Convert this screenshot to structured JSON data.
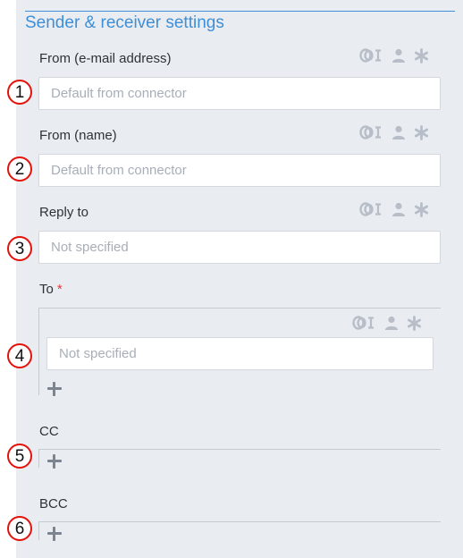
{
  "section": {
    "title": "Sender & receiver settings"
  },
  "fields": {
    "from_email": {
      "label": "From (e-mail address)",
      "placeholder": "Default from connector",
      "marker": "1"
    },
    "from_name": {
      "label": "From (name)",
      "placeholder": "Default from connector",
      "marker": "2"
    },
    "reply_to": {
      "label": "Reply to",
      "placeholder": "Not specified",
      "marker": "3"
    },
    "to": {
      "label": "To",
      "required_mark": "*",
      "placeholder": "Not specified",
      "marker": "4"
    },
    "cc": {
      "label": "CC",
      "marker": "5"
    },
    "bcc": {
      "label": "BCC",
      "marker": "6"
    }
  },
  "icon_names": [
    "link-variable-icon",
    "user-icon",
    "asterisk-icon"
  ],
  "colors": {
    "accent": "#3f8fd6",
    "panel_bg": "#e9ecf1",
    "icon_muted": "#b7bec8",
    "required": "#e23b3b",
    "annotation_red": "#e3120b"
  }
}
